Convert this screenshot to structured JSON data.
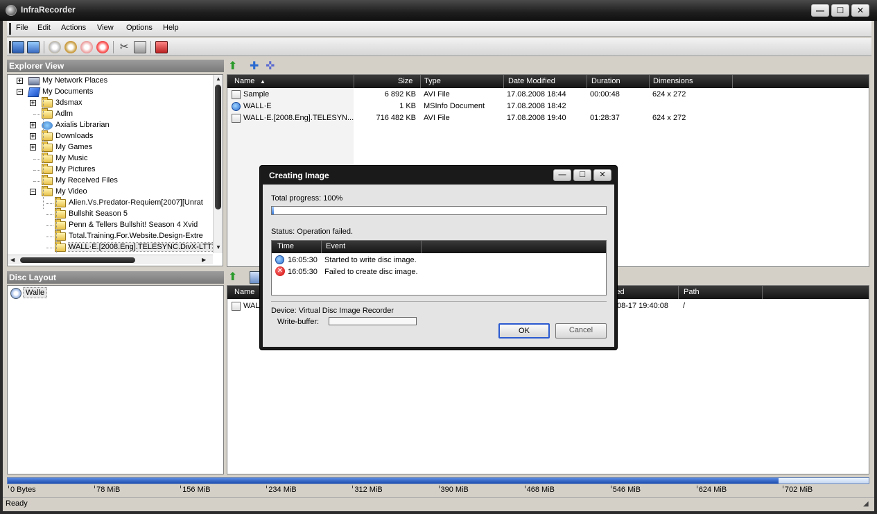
{
  "window": {
    "title": "InfraRecorder",
    "minimize": "—",
    "maximize": "☐",
    "close": "✕"
  },
  "menu": [
    "File",
    "Edit",
    "Actions",
    "View",
    "Options",
    "Help"
  ],
  "explorer": {
    "header": "Explorer View",
    "tree": [
      {
        "label": "My Network Places",
        "icon": "network-places-icon",
        "level": 0,
        "expander": "+"
      },
      {
        "label": "My Documents",
        "icon": "my-documents-icon",
        "level": 0,
        "expander": "−"
      },
      {
        "label": "3dsmax",
        "icon": "folder-icon",
        "level": 1,
        "expander": "+"
      },
      {
        "label": "Adlm",
        "icon": "folder-icon",
        "level": 1,
        "expander": ""
      },
      {
        "label": "Axialis Librarian",
        "icon": "special-folder-icon",
        "level": 1,
        "expander": "+"
      },
      {
        "label": "Downloads",
        "icon": "folder-icon",
        "level": 1,
        "expander": "+"
      },
      {
        "label": "My Games",
        "icon": "folder-icon",
        "level": 1,
        "expander": "+"
      },
      {
        "label": "My Music",
        "icon": "music-folder-icon",
        "level": 1,
        "expander": ""
      },
      {
        "label": "My Pictures",
        "icon": "pictures-folder-icon",
        "level": 1,
        "expander": ""
      },
      {
        "label": "My Received Files",
        "icon": "folder-icon",
        "level": 1,
        "expander": ""
      },
      {
        "label": "My Video",
        "icon": "folder-icon",
        "level": 1,
        "expander": "−"
      },
      {
        "label": "Alien.Vs.Predator-Requiem[2007][Unrat",
        "icon": "folder-icon",
        "level": 2,
        "expander": ""
      },
      {
        "label": "Bullshit Season 5",
        "icon": "folder-icon",
        "level": 2,
        "expander": ""
      },
      {
        "label": "Penn & Tellers Bullshit! Season 4 Xvid",
        "icon": "folder-icon",
        "level": 2,
        "expander": ""
      },
      {
        "label": "Total.Training.For.Website.Design-Extre",
        "icon": "folder-icon",
        "level": 2,
        "expander": ""
      },
      {
        "label": "WALL·E.[2008.Eng].TELESYNC.DivX-LTT",
        "icon": "folder-icon",
        "level": 2,
        "expander": ""
      }
    ],
    "columns": [
      "Name",
      "Size",
      "Type",
      "Date Modified",
      "Duration",
      "Dimensions"
    ],
    "files": [
      {
        "name": "Sample",
        "size": "6 892 KB",
        "type": "AVI File",
        "date": "17.08.2008 18:44",
        "duration": "00:00:48",
        "dimensions": "624 x 272",
        "icon": "video-file-icon"
      },
      {
        "name": "WALL·E",
        "size": "1 KB",
        "type": "MSInfo Document",
        "date": "17.08.2008 18:42",
        "duration": "",
        "dimensions": "",
        "icon": "info-file-icon"
      },
      {
        "name": "WALL·E.[2008.Eng].TELESYN...",
        "size": "716 482 KB",
        "type": "AVI File",
        "date": "17.08.2008 19:40",
        "duration": "01:28:37",
        "dimensions": "624 x 272",
        "icon": "video-file-icon"
      }
    ]
  },
  "disc": {
    "header": "Disc Layout",
    "root": "Walle",
    "columns": [
      "Name",
      "ied",
      "Path"
    ],
    "files": [
      {
        "name": "WALL",
        "date": "08-17 19:40:08",
        "path": "/"
      }
    ]
  },
  "capacity": {
    "labels": [
      "0 Bytes",
      "78 MiB",
      "156 MiB",
      "234 MiB",
      "312 MiB",
      "390 MiB",
      "468 MiB",
      "546 MiB",
      "624 MiB",
      "702 MiB"
    ],
    "used_fraction": 0.895
  },
  "status": "Ready",
  "dialog": {
    "title": "Creating Image",
    "total_progress": "Total progress: 100%",
    "progress_fraction": 0.006,
    "status": "Status: Operation failed.",
    "columns": [
      "Time",
      "Event"
    ],
    "events": [
      {
        "time": "16:05:30",
        "event": "Started to write disc image.",
        "icon": "info-icon"
      },
      {
        "time": "16:05:30",
        "event": "Failed to create disc image.",
        "icon": "error-icon"
      }
    ],
    "device": "Device: Virtual Disc Image Recorder",
    "write_buffer": "Write-buffer:",
    "ok": "OK",
    "cancel": "Cancel"
  },
  "colors": {
    "titlebar": "#1e1e1e",
    "header": "#141414",
    "panel_header": "#8a8a8a",
    "capacity_fill": "#1c4cb0"
  }
}
